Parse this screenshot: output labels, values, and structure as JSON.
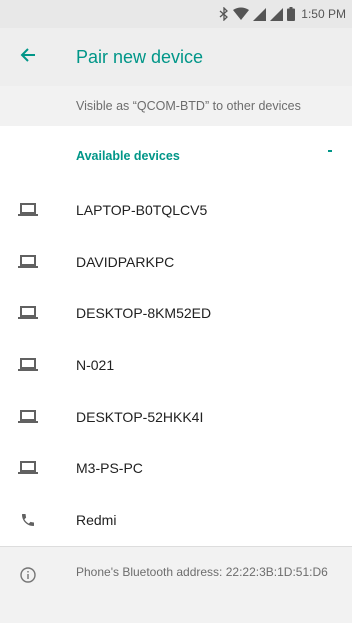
{
  "status_bar": {
    "time": "1:50 PM",
    "icons": [
      "bluetooth-icon",
      "wifi-icon",
      "signal-icon",
      "signal-icon",
      "battery-icon"
    ]
  },
  "app_bar": {
    "title": "Pair new device",
    "back_icon": "arrow-back-icon"
  },
  "visible_as": "Visible as “QCOM-BTD” to other devices",
  "section": {
    "title": "Available devices"
  },
  "devices": [
    {
      "name": "LAPTOP-B0TQLCV5",
      "icon": "laptop-icon"
    },
    {
      "name": "DAVIDPARKPC",
      "icon": "laptop-icon"
    },
    {
      "name": "DESKTOP-8KM52ED",
      "icon": "laptop-icon"
    },
    {
      "name": "N-021",
      "icon": "laptop-icon"
    },
    {
      "name": "DESKTOP-52HKK4I",
      "icon": "laptop-icon"
    },
    {
      "name": "M3-PS-PC",
      "icon": "laptop-icon"
    },
    {
      "name": "Redmi",
      "icon": "phone-icon"
    }
  ],
  "footer": {
    "bluetooth_address": "Phone's Bluetooth address: 22:22:3B:1D:51:D6",
    "icon": "info-icon"
  },
  "colors": {
    "accent": "#009688",
    "app_bar_bg": "#eeeeee",
    "status_bar_bg": "#e8e8e8",
    "secondary_text": "#6d6d6d"
  }
}
